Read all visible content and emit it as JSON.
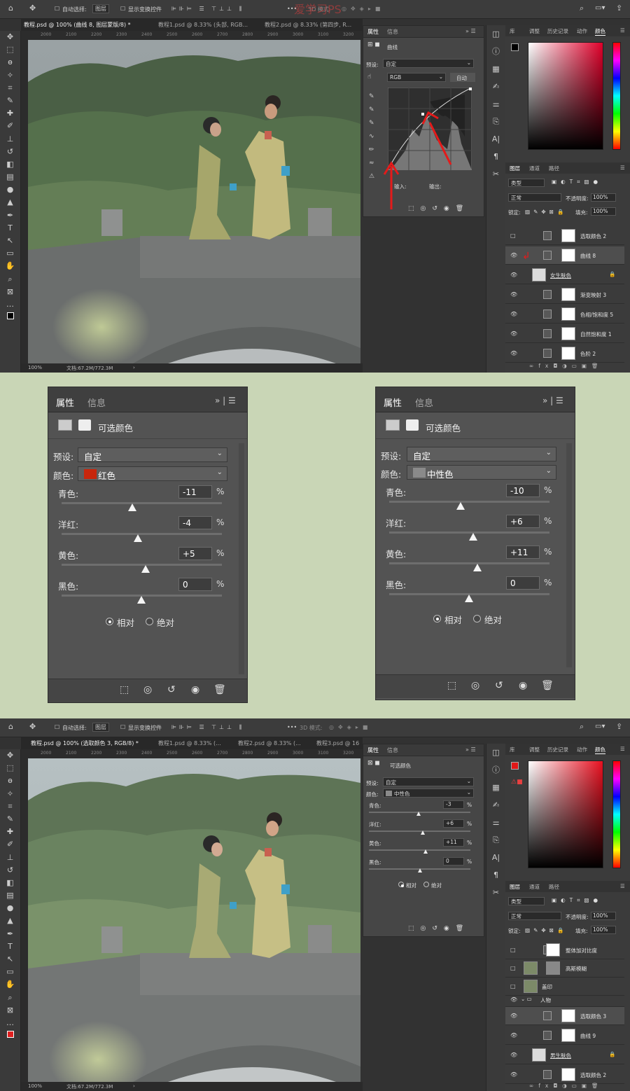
{
  "watermark": "爱学习PS",
  "screen1": {
    "options": {
      "auto_select": "自动选择:",
      "layer_select": "图层",
      "show_transform": "显示变换控件",
      "mode3d": "3D 模式:"
    },
    "tabs": [
      "教程.psd @ 100% (曲线 8, 图层蒙版/8) *",
      "教程1.psd @ 8.33% (头部, RGB...",
      "教程2.psd @ 8.33% (第四步, R..."
    ],
    "ruler": [
      "2000",
      "2100",
      "2200",
      "2300",
      "2400",
      "2500",
      "2600",
      "2700",
      "2800",
      "2900",
      "3000",
      "3100",
      "3200"
    ],
    "status_zoom": "100%",
    "status_doc": "文档:67.2M/772.3M",
    "props": {
      "tab1": "属性",
      "tab2": "信息",
      "title": "曲线",
      "preset_label": "预设:",
      "preset_value": "自定",
      "channel": "RGB",
      "auto": "自动",
      "input_label": "输入:",
      "output_label": "输出:"
    },
    "right_tabs": [
      "库",
      "调整",
      "历史记录",
      "动作",
      "颜色"
    ],
    "layer_tabs": [
      "图层",
      "通道",
      "路径"
    ],
    "filter_kind": "类型",
    "blend_mode": "正常",
    "opacity_label": "不透明度:",
    "opacity": "100%",
    "lock_label": "锁定:",
    "fill_label": "填充:",
    "fill": "100%",
    "layers": [
      "选取颜色 2",
      "曲线 8",
      "女生肤色",
      "渐变映射 3",
      "色相/饱和度 5",
      "自然饱和度 1",
      "色阶 2"
    ]
  },
  "panel_left": {
    "tab1": "属性",
    "tab2": "信息",
    "title": "可选颜色",
    "preset_label": "预设:",
    "preset_value": "自定",
    "color_label": "颜色:",
    "color_value": "红色",
    "color_swatch": "#c8260c",
    "sliders": [
      {
        "label": "青色:",
        "value": "-11"
      },
      {
        "label": "洋红:",
        "value": "-4"
      },
      {
        "label": "黄色:",
        "value": "+5"
      },
      {
        "label": "黑色:",
        "value": "0"
      }
    ],
    "pct": "%",
    "relative": "相对",
    "absolute": "绝对"
  },
  "panel_right": {
    "tab1": "属性",
    "tab2": "信息",
    "title": "可选颜色",
    "preset_label": "预设:",
    "preset_value": "自定",
    "color_label": "颜色:",
    "color_value": "中性色",
    "color_swatch": "#8a8a8a",
    "sliders": [
      {
        "label": "青色:",
        "value": "-10"
      },
      {
        "label": "洋红:",
        "value": "+6"
      },
      {
        "label": "黄色:",
        "value": "+11"
      },
      {
        "label": "黑色:",
        "value": "0"
      }
    ],
    "pct": "%",
    "relative": "相对",
    "absolute": "绝对"
  },
  "screen2": {
    "options": {
      "auto_select": "自动选择:",
      "layer_select": "图层",
      "show_transform": "显示变换控件",
      "mode3d": "3D 模式:"
    },
    "tabs": [
      "教程.psd @ 100% (选取颜色 3, RGB/8) *",
      "教程1.psd @ 8.33% (...",
      "教程2.psd @ 8.33% (...",
      "教程3.psd @ 16"
    ],
    "ruler": [
      "2000",
      "2100",
      "2200",
      "2300",
      "2400",
      "2500",
      "2600",
      "2700",
      "2800",
      "2900",
      "3000",
      "3100",
      "3200"
    ],
    "status_zoom": "100%",
    "status_doc": "文档:67.2M/772.3M",
    "props": {
      "tab1": "属性",
      "tab2": "信息",
      "title": "可选颜色",
      "preset_label": "预设:",
      "preset_value": "自定",
      "color_label": "颜色:",
      "color_value": "中性色",
      "sliders": [
        {
          "label": "青色:",
          "value": "-3"
        },
        {
          "label": "洋红:",
          "value": "+6"
        },
        {
          "label": "黄色:",
          "value": "+11"
        },
        {
          "label": "黑色:",
          "value": "0"
        }
      ],
      "relative": "相对",
      "absolute": "绝对",
      "pct": "%"
    },
    "right_tabs": [
      "库",
      "调整",
      "历史记录",
      "动作",
      "颜色"
    ],
    "layer_tabs": [
      "图层",
      "通道",
      "路径"
    ],
    "filter_kind": "类型",
    "blend_mode": "正常",
    "opacity_label": "不透明度:",
    "opacity": "100%",
    "lock_label": "锁定:",
    "fill_label": "填充:",
    "fill": "100%",
    "layers": [
      "整体加对比度",
      "高斯模糊",
      "盖印",
      "人物",
      "选取颜色 3",
      "曲线 9",
      "男生肤色",
      "选取颜色 2"
    ]
  }
}
